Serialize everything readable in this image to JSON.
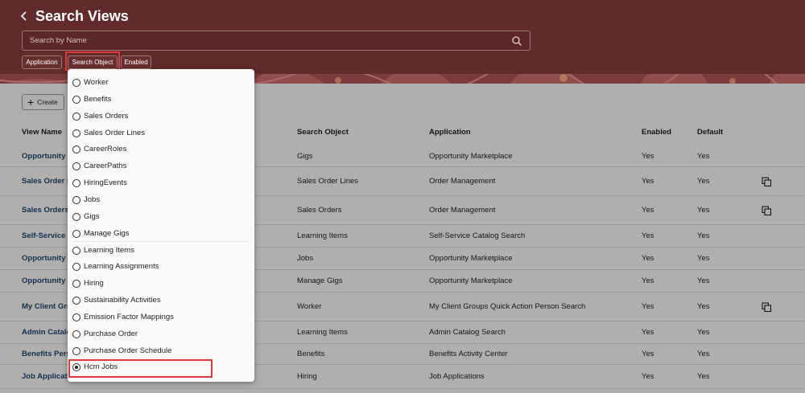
{
  "header": {
    "title": "Search Views",
    "search_placeholder": "Search by Name",
    "filters": [
      "Application",
      "Search Object",
      "Enabled"
    ],
    "back_icon": "chevron-left-icon"
  },
  "toolbar": {
    "create_label": "Create"
  },
  "table": {
    "columns": {
      "view_name": "View Name",
      "search_object": "Search Object",
      "application": "Application",
      "enabled": "Enabled",
      "default": "Default"
    },
    "rows": [
      {
        "name": "Opportunity",
        "search_object": "Gigs",
        "application": "Opportunity Marketplace",
        "enabled": "Yes",
        "default": "Yes",
        "copy": false
      },
      {
        "name": "Sales Order L",
        "search_object": "Sales Order Lines",
        "application": "Order Management",
        "enabled": "Yes",
        "default": "Yes",
        "copy": true
      },
      {
        "name": "Sales Orders",
        "search_object": "Sales Orders",
        "application": "Order Management",
        "enabled": "Yes",
        "default": "Yes",
        "copy": true
      },
      {
        "name": "Self-Service (",
        "search_object": "Learning Items",
        "application": "Self-Service Catalog Search",
        "enabled": "Yes",
        "default": "Yes",
        "copy": false
      },
      {
        "name": "Opportunity",
        "search_object": "Jobs",
        "application": "Opportunity Marketplace",
        "enabled": "Yes",
        "default": "Yes",
        "copy": false
      },
      {
        "name": "Opportunity",
        "search_object": "Manage Gigs",
        "application": "Opportunity Marketplace",
        "enabled": "Yes",
        "default": "Yes",
        "copy": false
      },
      {
        "name": "My Client Gro",
        "search_object": "Worker",
        "application": "My Client Groups Quick Action Person Search",
        "enabled": "Yes",
        "default": "Yes",
        "copy": true
      },
      {
        "name": "Admin Catalo",
        "search_object": "Learning Items",
        "application": "Admin Catalog Search",
        "enabled": "Yes",
        "default": "Yes",
        "copy": false
      },
      {
        "name": "Benefits Pers",
        "search_object": "Benefits",
        "application": "Benefits Activity Center",
        "enabled": "Yes",
        "default": "Yes",
        "copy": false
      },
      {
        "name": "Job Applicati",
        "search_object": "Hiring",
        "application": "Job Applications",
        "enabled": "Yes",
        "default": "Yes",
        "copy": false
      }
    ]
  },
  "dropdown": {
    "options": [
      "Worker",
      "Benefits",
      "Sales Orders",
      "Sales Order Lines",
      "CareerRoles",
      "CareerPaths",
      "HiringEvents",
      "Jobs",
      "Gigs",
      "Manage Gigs",
      "Learning Items",
      "Learning Assignments",
      "Hiring",
      "Sustainability Activities",
      "Emission Factor Mappings",
      "Purchase Order",
      "Purchase Order Schedule",
      "Hcm Jobs"
    ],
    "selected": "Hcm Jobs"
  },
  "colors": {
    "header_bg": "#612a2b",
    "link": "#19466e",
    "highlight": "#e0393b"
  }
}
